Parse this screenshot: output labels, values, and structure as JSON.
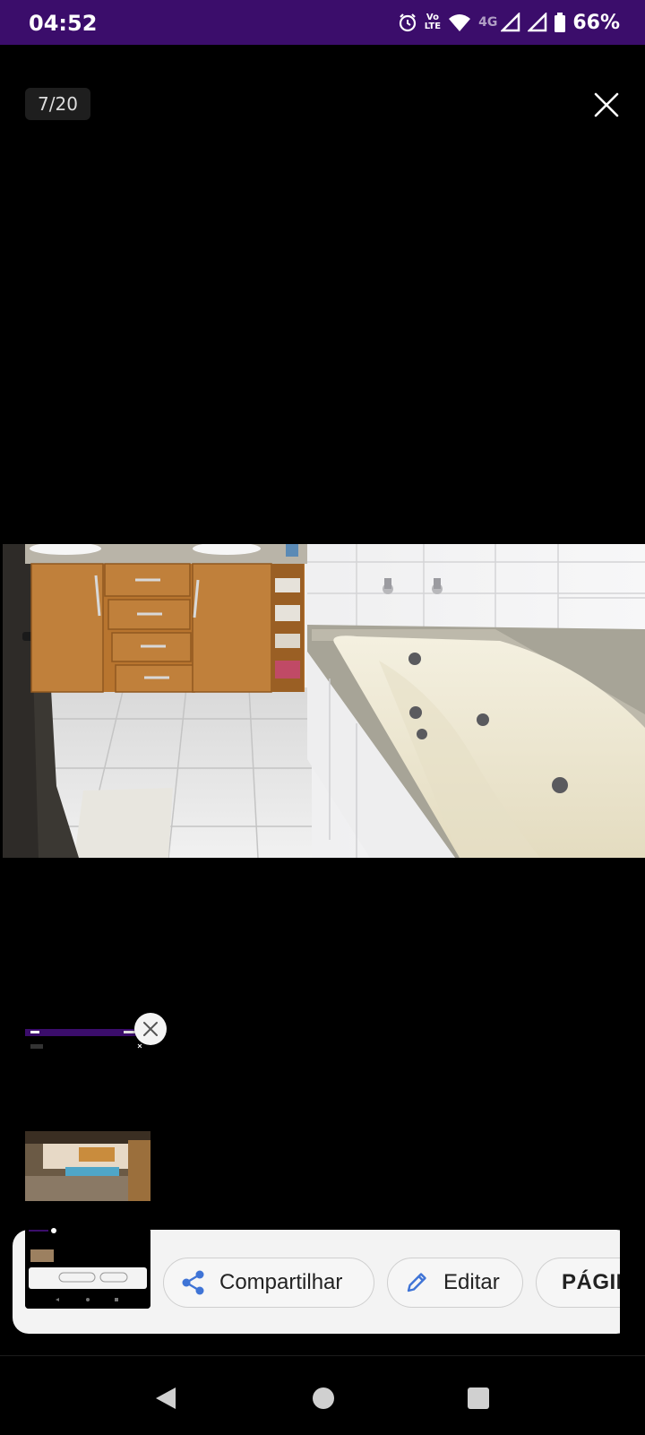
{
  "status_bar": {
    "time": "04:52",
    "volte_top": "Vo",
    "volte_bottom": "LTE",
    "network_type": "4G",
    "battery": "66%",
    "icons": [
      "alarm-icon",
      "volte-icon",
      "wifi-icon",
      "signal-icon",
      "signal-icon",
      "battery-icon"
    ]
  },
  "viewer": {
    "counter": "7/20",
    "close_icon": "close-icon",
    "photo_subject": "bathroom with jacuzzi bathtub"
  },
  "screenshot_toolbar": {
    "share_label": "Compartilhar",
    "edit_label": "Editar",
    "page_label": "PÁGIN",
    "share_icon": "share-icon",
    "edit_icon": "pencil-icon"
  },
  "nav_bar": {
    "icons": [
      "back-icon",
      "home-icon",
      "recents-icon"
    ]
  },
  "colors": {
    "status_bar": "#3b0d6b",
    "accent_blue": "#3f74d6",
    "background": "#000000"
  }
}
